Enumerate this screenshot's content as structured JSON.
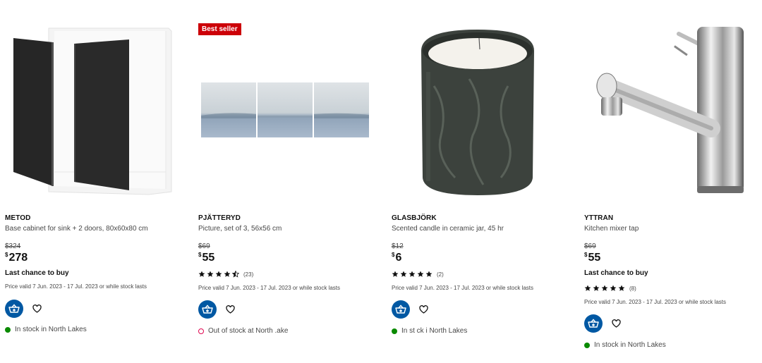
{
  "products": [
    {
      "name": "METOD",
      "description": "Base cabinet for sink + 2 doors, 80x60x80 cm",
      "old_price": "$324",
      "currency": "$",
      "price": "278",
      "last_chance": "Last chance to buy",
      "price_valid": "Price valid 7 Jun. 2023 - 17 Jul. 2023 or while stock lasts",
      "stock": "In stock in North Lakes",
      "stock_status": "in"
    },
    {
      "badge": "Best seller",
      "name": "PJÄTTERYD",
      "description": "Picture, set of 3, 56x56 cm",
      "old_price": "$69",
      "currency": "$",
      "price": "55",
      "rating": 4.5,
      "rating_count": "(23)",
      "price_valid": "Price valid 7 Jun. 2023 - 17 Jul. 2023 or while stock lasts",
      "stock": "Out of stock at North  .ake",
      "stock_status": "out"
    },
    {
      "name": "GLASBJÖRK",
      "description": "Scented candle in ceramic jar, 45 hr",
      "old_price": "$12",
      "currency": "$",
      "price": "6",
      "rating": 5,
      "rating_count": "(2)",
      "price_valid": "Price valid 7 Jun. 2023 - 17 Jul. 2023 or while stock lasts",
      "stock": "In st  ck i   North Lakes",
      "stock_status": "in"
    },
    {
      "name": "YTTRAN",
      "description": "Kitchen mixer tap",
      "old_price": "$69",
      "currency": "$",
      "price": "55",
      "last_chance": "Last chance to buy",
      "rating": 5,
      "rating_count": "(8)",
      "price_valid": "Price valid 7 Jun. 2023 - 17 Jul. 2023 or while stock lasts",
      "stock": "In stock in North Lakes",
      "stock_status": "in"
    }
  ],
  "colors": {
    "badge": "#cc0008",
    "cart_button": "#0058a3",
    "in_stock": "#0a8a00",
    "out_of_stock": "#e00751"
  }
}
